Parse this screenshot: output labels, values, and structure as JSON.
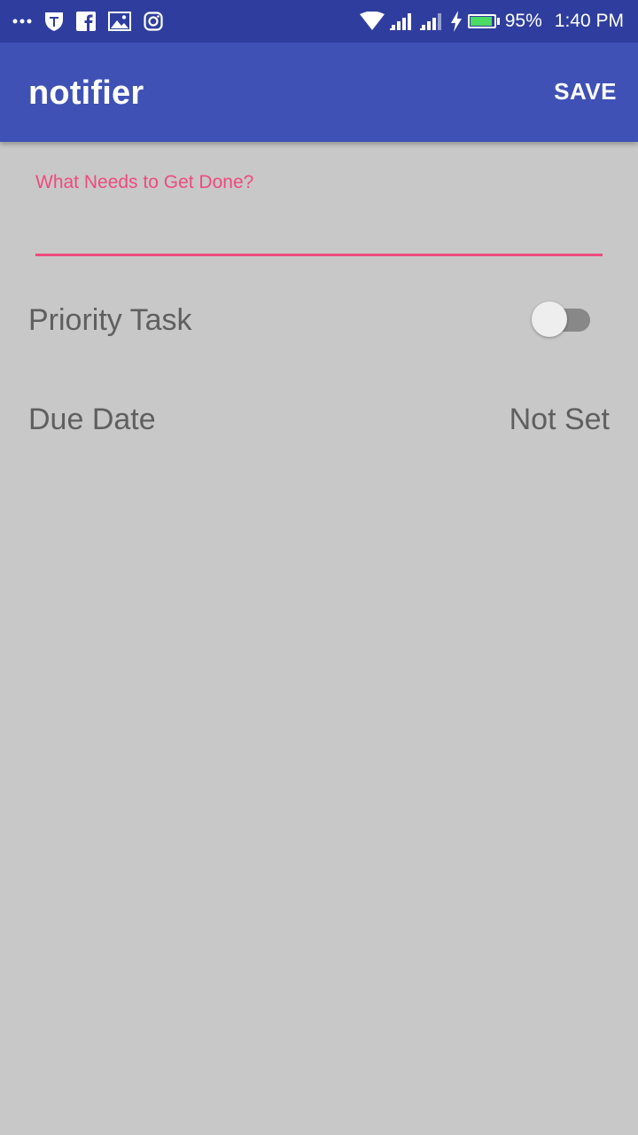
{
  "status_bar": {
    "left_icons": [
      "more-dots-icon",
      "shield-app-icon",
      "facebook-icon",
      "gallery-icon",
      "instagram-icon"
    ],
    "right_icons": [
      "wifi-icon",
      "signal-icon",
      "signal-icon",
      "charging-icon",
      "battery-icon"
    ],
    "battery_percent_text": "95%",
    "battery_level": 0.95,
    "time": "1:40 PM"
  },
  "app_bar": {
    "title": "notifier",
    "save_label": "SAVE",
    "color": "#3f51b5"
  },
  "form": {
    "task_label": "What Needs to Get Done?",
    "task_value": "",
    "priority_label": "Priority Task",
    "priority_on": false,
    "due_date_label": "Due Date",
    "due_date_value": "Not Set",
    "accent_color": "#ee4a7e"
  }
}
